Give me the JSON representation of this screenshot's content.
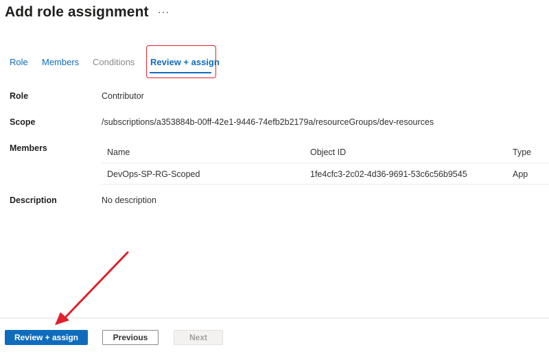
{
  "header": {
    "title": "Add role assignment",
    "more_label": "···"
  },
  "tabs": [
    {
      "label": "Role",
      "state": "enabled"
    },
    {
      "label": "Members",
      "state": "enabled"
    },
    {
      "label": "Conditions",
      "state": "disabled"
    },
    {
      "label": "Review + assign",
      "state": "active"
    }
  ],
  "summary": {
    "role": {
      "label": "Role",
      "value": "Contributor"
    },
    "scope": {
      "label": "Scope",
      "value": "/subscriptions/a353884b-00ff-42e1-9446-74efb2b2179a/resourceGroups/dev-resources"
    },
    "members": {
      "label": "Members",
      "columns": [
        "Name",
        "Object ID",
        "Type"
      ],
      "rows": [
        {
          "name": "DevOps-SP-RG-Scoped",
          "object_id": "1fe4cfc3-2c02-4d36-9691-53c6c56b9545",
          "type": "App"
        }
      ]
    },
    "description": {
      "label": "Description",
      "value": "No description"
    }
  },
  "footer": {
    "review_assign_label": "Review + assign",
    "previous_label": "Previous",
    "next_label": "Next"
  },
  "colors": {
    "accent": "#0f6cbd",
    "annotation": "#e0202a"
  }
}
